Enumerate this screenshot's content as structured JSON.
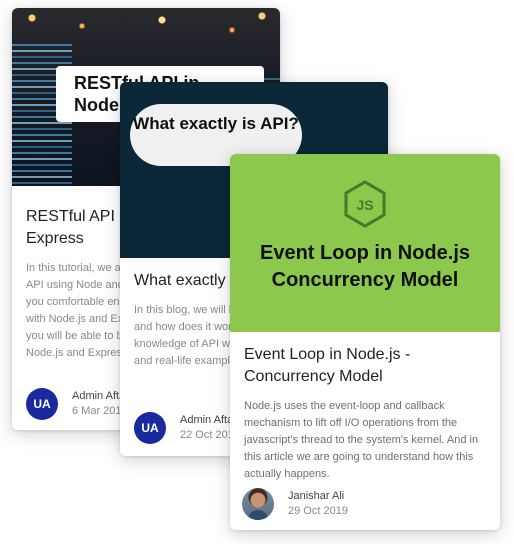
{
  "cards": [
    {
      "image_title": "RESTful API in Node.js",
      "title": "RESTful API in Node.js with Express",
      "description": "In this tutorial, we are going to build a RESTful API using Node and Express. Which will make you comfortable enough to build the REST API with Node.js and Express. After reading this blog, you will be able to build RESTful API using Node.js and Express.",
      "avatar_text": "UA",
      "author": "Admin Aftab",
      "date": "6 Mar 2019"
    },
    {
      "image_title": "What exactly is API?",
      "title": "What exactly is API?",
      "description": "In this blog, we will look at what exactly is API and how does it work. Here you will get the knowledge of API with the help of some concepts and real-life example.",
      "avatar_text": "UA",
      "author": "Admin Aftab",
      "date": "22 Oct 2019"
    },
    {
      "icon": "nodejs-logo-icon",
      "image_title": "Event Loop in Node.js Concurrency Model",
      "title": "Event Loop in Node.js - Concurrency Model",
      "description": "Node.js uses the event-loop and callback mechanism to lift off I/O operations from the javascript's thread to the system's kernel. And in this article we are going to understand how this actually happens.",
      "author": "Janishar Ali",
      "date": "29 Oct 2019"
    }
  ],
  "colors": {
    "green": "#8cc84b",
    "navy": "#0b2839",
    "avatar_blue": "#1a2a9e"
  }
}
